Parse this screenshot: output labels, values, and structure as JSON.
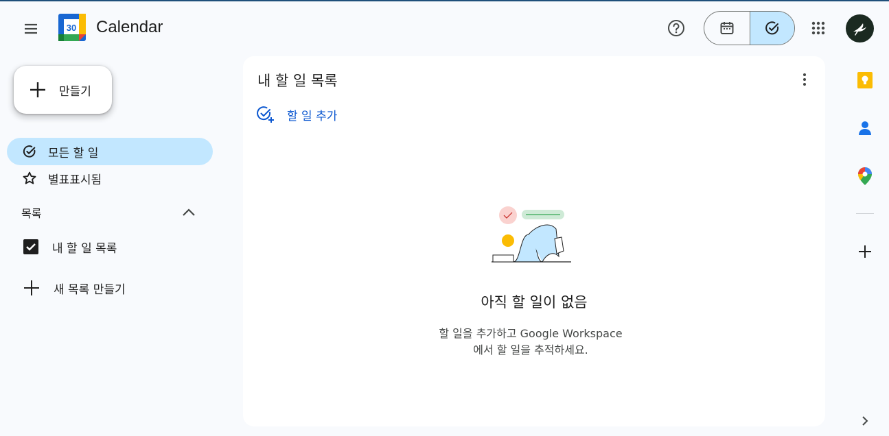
{
  "header": {
    "app_title": "Calendar",
    "logo_day": "30",
    "icons": [
      "menu-icon",
      "help-icon",
      "calendar-icon",
      "tasks-icon",
      "apps-grid-icon",
      "avatar"
    ]
  },
  "sidebar": {
    "create_label": "만들기",
    "nav": [
      {
        "label": "모든 할 일",
        "icon": "check-circle-icon",
        "active": true
      },
      {
        "label": "별표표시됨",
        "icon": "star-icon",
        "active": false
      }
    ],
    "lists_section": {
      "title": "목록",
      "items": [
        {
          "label": "내 할 일 목록",
          "checked": true
        }
      ],
      "new_list_label": "새 목록 만들기"
    }
  },
  "main": {
    "title": "내 할 일 목록",
    "add_task_label": "할 일 추가",
    "empty": {
      "title": "아직 할 일이 없음",
      "desc_line1": "할 일을 추가하고 Google Workspace",
      "desc_line2": "에서 할 일을 추적하세요."
    }
  },
  "side_panel": {
    "icons": [
      "keep-icon",
      "contacts-icon",
      "maps-icon",
      "add-icon",
      "expand-icon"
    ]
  },
  "colors": {
    "accent": "#0b57d0",
    "active_bg": "#c2e7ff",
    "page_bg": "#f8fafd",
    "card_bg": "#ffffff"
  }
}
